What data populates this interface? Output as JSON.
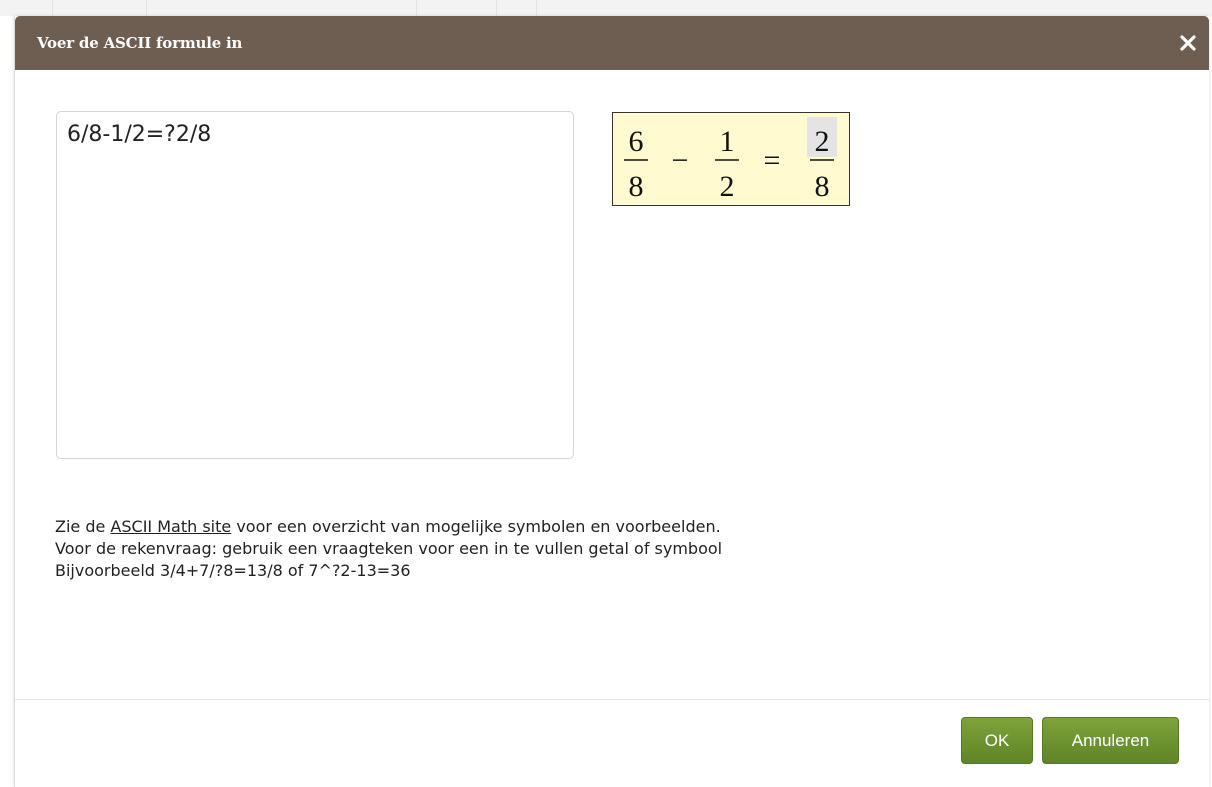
{
  "dialog": {
    "title": "Voer de ASCII formule in",
    "close_icon": "close-icon"
  },
  "editor": {
    "value": "6/8-1/2=?2/8"
  },
  "preview": {
    "n1": "6",
    "d1": "8",
    "op1": "−",
    "n2": "1",
    "d2": "2",
    "op2": "=",
    "n3": "2",
    "d3": "8"
  },
  "help": {
    "line1_prefix": "Zie de ",
    "link": "ASCII Math site",
    "line1_suffix": " voor een overzicht van mogelijke symbolen en voorbeelden.",
    "line2": "Voor de rekenvraag: gebruik een vraagteken voor een in te vullen getal of symbool",
    "line3": "Bijvoorbeeld 3/4+7/?8=13/8 of 7^?2-13=36"
  },
  "buttons": {
    "ok": "OK",
    "cancel": "Annuleren"
  },
  "colors": {
    "titlebar": "#6e5d51",
    "button": "#6a9430",
    "preview_bg": "#fffad0"
  }
}
